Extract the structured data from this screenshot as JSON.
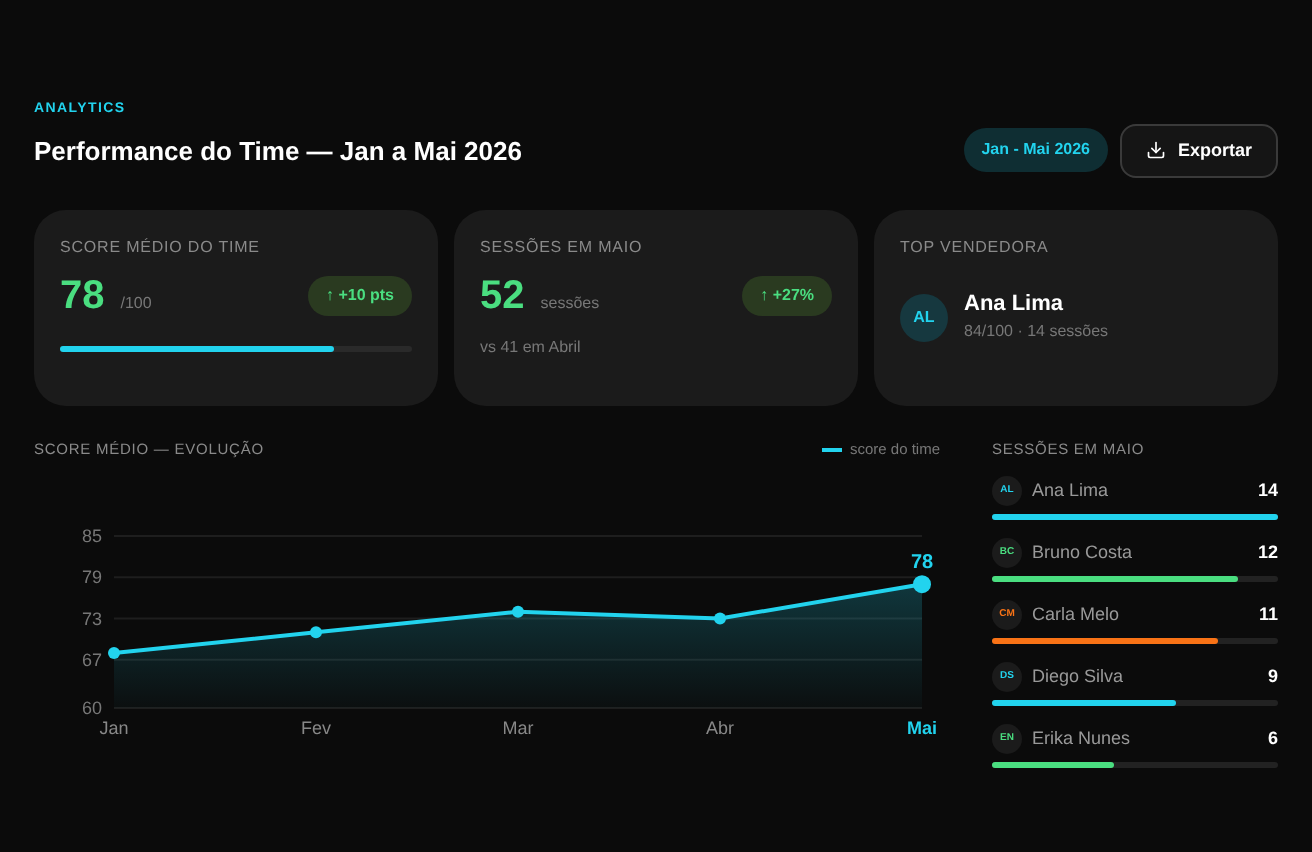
{
  "header": {
    "eyebrow": "ANALYTICS",
    "title": "Performance do Time — Jan a Mai 2026",
    "period": "Jan - Mai 2026",
    "export_button": "Exportar"
  },
  "cards": [
    {
      "kind": "score",
      "label": "SCORE MÉDIO DO TIME",
      "value": "78",
      "unit": "/100",
      "delta": "↑ +10 pts",
      "level": 0.78
    },
    {
      "kind": "sessions",
      "label": "SESSÕES EM MAIO",
      "value": "52",
      "unit": "sessões",
      "delta": "↑ +27%",
      "note": "vs 41 em Abril"
    },
    {
      "kind": "top",
      "label": "TOP VENDEDORA",
      "initials": "AL",
      "name": "Ana Lima",
      "detail": "84/100 · 14 sessões"
    }
  ],
  "chart": {
    "title": "SCORE MÉDIO — EVOLUÇÃO",
    "last_label": "78",
    "chart_data": {
      "type": "area",
      "grid": true,
      "categories": [
        "Jan",
        "Fev",
        "Mar",
        "Abr",
        "Mai"
      ],
      "series": [
        {
          "name": "score do time",
          "color": "#22d3ee",
          "values": [
            68,
            71,
            74,
            73,
            78
          ]
        }
      ],
      "ylim": [
        60,
        85
      ],
      "yticks": [
        60,
        67,
        73,
        79,
        85
      ]
    }
  },
  "sessions": {
    "title": "SESSÕES EM MAIO",
    "items": [
      {
        "initials": "AL",
        "name": "Ana Lima",
        "count": "14",
        "level": 1.0,
        "color": "#22d3ee"
      },
      {
        "initials": "BC",
        "name": "Bruno Costa",
        "count": "12",
        "level": 0.86,
        "color": "#4ade80"
      },
      {
        "initials": "CM",
        "name": "Carla Melo",
        "count": "11",
        "level": 0.79,
        "color": "#f97316"
      },
      {
        "initials": "DS",
        "name": "Diego Silva",
        "count": "9",
        "level": 0.64,
        "color": "#22d3ee"
      },
      {
        "initials": "EN",
        "name": "Erika Nunes",
        "count": "6",
        "level": 0.43,
        "color": "#4ade80"
      }
    ]
  }
}
